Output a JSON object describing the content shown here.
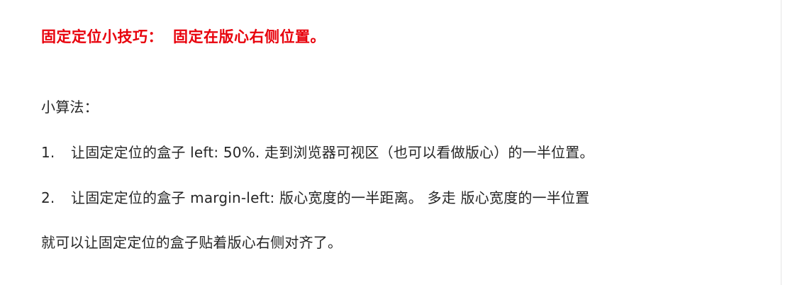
{
  "heading": {
    "prefix": "固定定位小技巧：",
    "text": "固定在版心右侧位置。"
  },
  "algorithm_label": "小算法：",
  "steps": [
    {
      "number": "1.",
      "text": "让固定定位的盒子 left: 50%. 走到浏览器可视区（也可以看做版心）的一半位置。"
    },
    {
      "number": "2.",
      "text": "让固定定位的盒子 margin-left: 版心宽度的一半距离。 多走 版心宽度的一半位置"
    }
  ],
  "conclusion": "就可以让固定定位的盒子贴着版心右侧对齐了。",
  "colors": {
    "heading": "#e8000b",
    "body_text": "#262626",
    "background": "#ffffff"
  }
}
